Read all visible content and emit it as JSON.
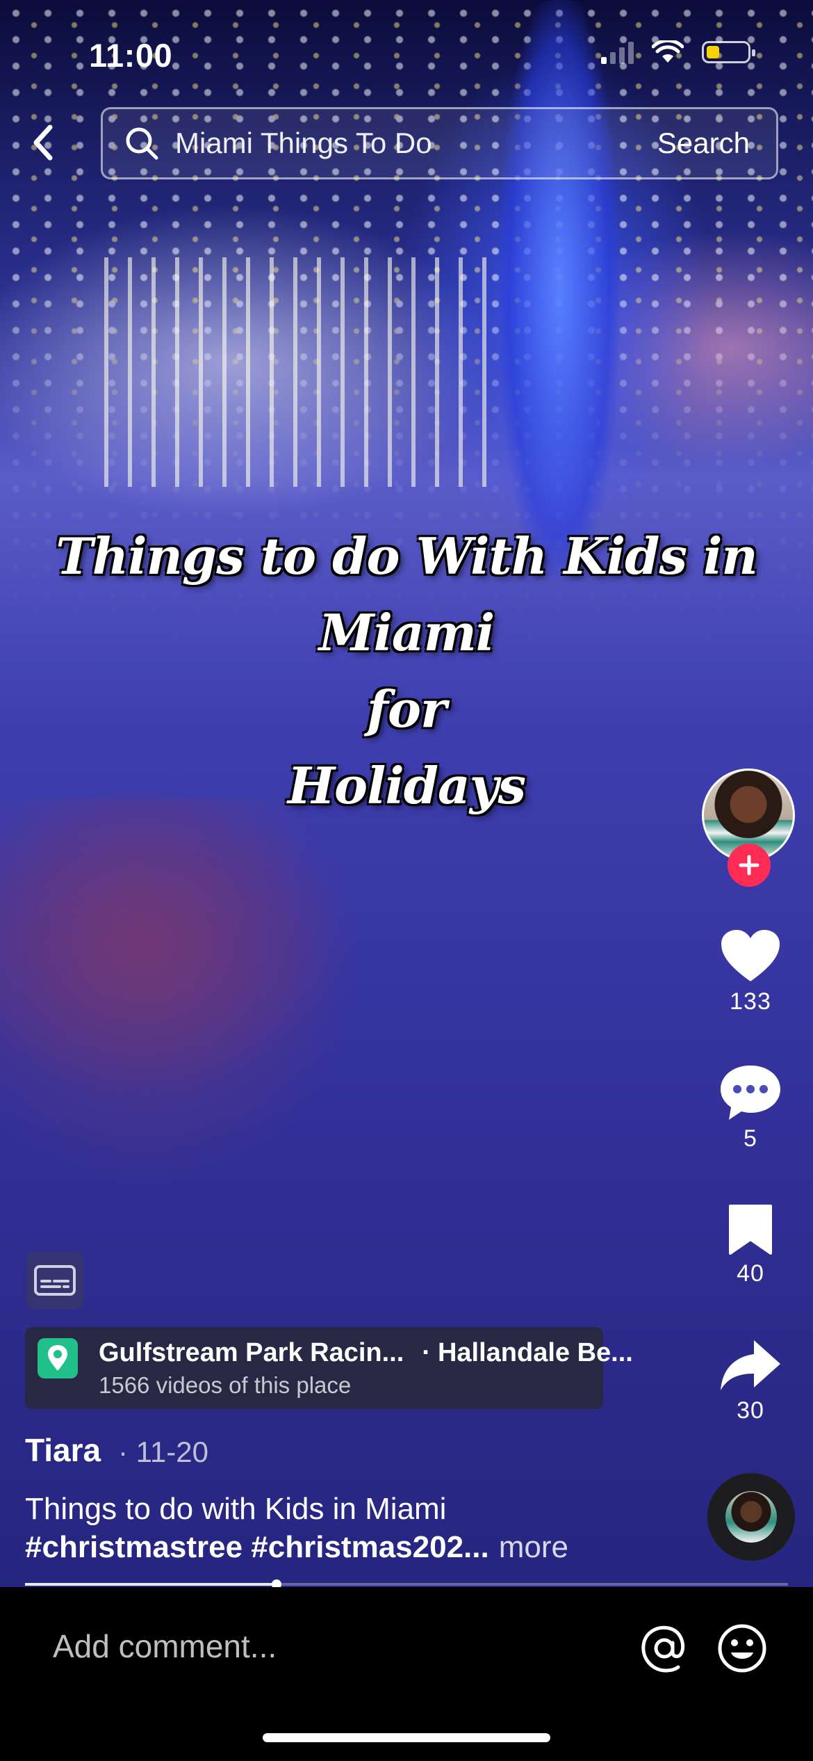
{
  "status_bar": {
    "time": "11:00"
  },
  "search": {
    "query": "Miami Things To Do",
    "button_label": "Search"
  },
  "video": {
    "overlay_lines": [
      "Things to do With Kids in",
      "Miami",
      "for",
      "Holidays"
    ],
    "progress_fraction": 0.33
  },
  "actions": {
    "likes": "133",
    "comments": "5",
    "saves": "40",
    "shares": "30"
  },
  "location": {
    "name": "Gulfstream Park Racin...",
    "separator": "·",
    "city": "Hallandale Be...",
    "videos_count": "1566 videos of this place"
  },
  "post": {
    "author": "Tiara",
    "date": "· 11-20",
    "caption_line1": "Things to do with Kids in Miami",
    "caption_line2": "#christmastree #christmas202...",
    "more_label": "more"
  },
  "comment_bar": {
    "placeholder": "Add comment..."
  },
  "colors": {
    "follow_badge": "#fe2c55",
    "location_pin": "#21c08b",
    "battery": "#f5d400"
  }
}
